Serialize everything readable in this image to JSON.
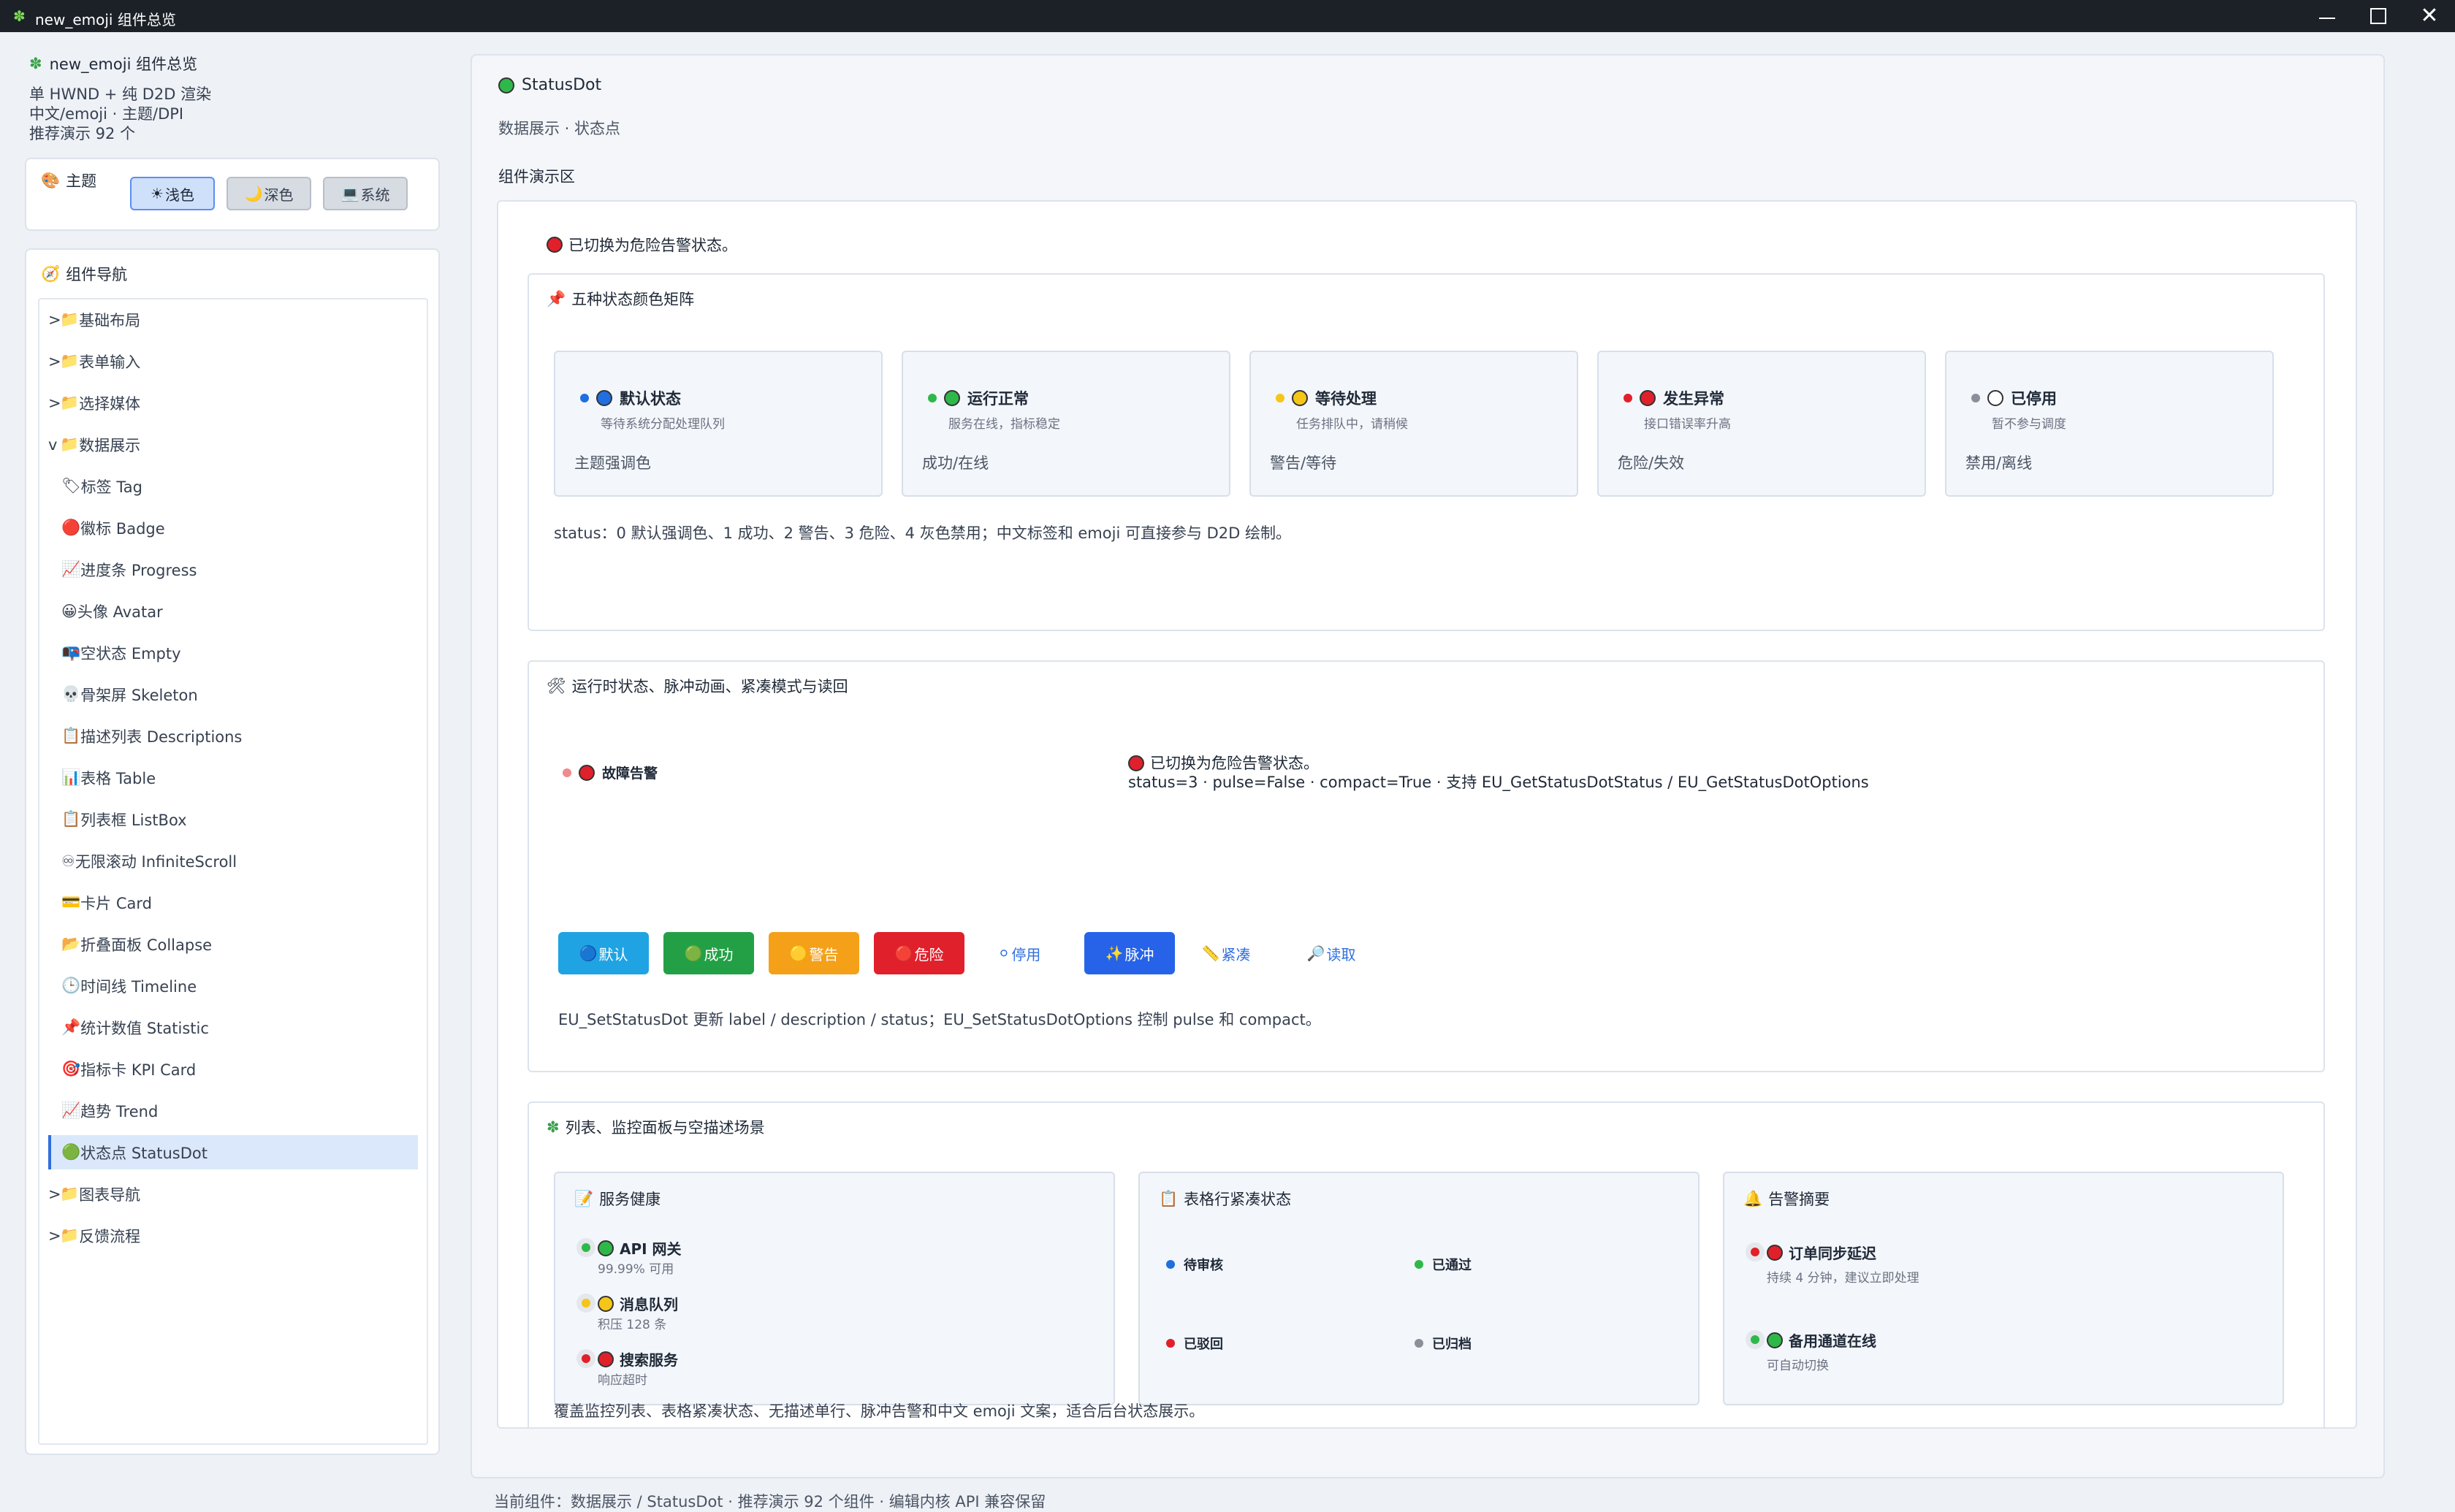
{
  "window": {
    "title": "new_emoji 组件总览"
  },
  "sidebar": {
    "title": "new_emoji 组件总览",
    "info": [
      "单 HWND + 纯 D2D 渲染",
      "中文/emoji · 主题/DPI",
      "推荐演示 92 个"
    ],
    "theme": {
      "label": "主题",
      "buttons": [
        {
          "icon": "☀",
          "label": "浅色"
        },
        {
          "icon": "🌙",
          "label": "深色"
        },
        {
          "icon": "💻",
          "label": "系统"
        }
      ]
    },
    "nav": {
      "label": "组件导航",
      "items": [
        {
          "caret": ">",
          "icon": "📁",
          "label": "基础布局"
        },
        {
          "caret": ">",
          "icon": "📁",
          "label": "表单输入"
        },
        {
          "caret": ">",
          "icon": "📁",
          "label": "选择媒体"
        },
        {
          "caret": "v",
          "icon": "📁",
          "label": "数据展示"
        },
        {
          "icon": "🏷",
          "label": "标签 Tag"
        },
        {
          "icon": "🔴",
          "label": "徽标 Badge"
        },
        {
          "icon": "📈",
          "label": "进度条 Progress"
        },
        {
          "icon": "😀",
          "label": "头像 Avatar"
        },
        {
          "icon": "📭",
          "label": "空状态 Empty"
        },
        {
          "icon": "💀",
          "label": "骨架屏 Skeleton"
        },
        {
          "icon": "📋",
          "label": "描述列表 Descriptions"
        },
        {
          "icon": "📊",
          "label": "表格 Table"
        },
        {
          "icon": "📋",
          "label": "列表框 ListBox"
        },
        {
          "icon": "♾",
          "label": "无限滚动 InfiniteScroll"
        },
        {
          "icon": "💳",
          "label": "卡片 Card"
        },
        {
          "icon": "📂",
          "label": "折叠面板 Collapse"
        },
        {
          "icon": "🕒",
          "label": "时间线 Timeline"
        },
        {
          "icon": "📌",
          "label": "统计数值 Statistic"
        },
        {
          "icon": "🎯",
          "label": "指标卡 KPI Card"
        },
        {
          "icon": "📈",
          "label": "趋势 Trend"
        },
        {
          "icon": "🟢",
          "label": "状态点 StatusDot"
        },
        {
          "caret": ">",
          "icon": "📁",
          "label": "图表导航"
        },
        {
          "caret": ">",
          "icon": "📁",
          "label": "反馈流程"
        }
      ]
    }
  },
  "main": {
    "title": "StatusDot",
    "subtitle": "数据展示 · 状态点",
    "demo_label": "组件演示区",
    "message": "已切换为危险告警状态。",
    "matrix": {
      "title": "五种状态颜色矩阵",
      "states": [
        {
          "label": "默认状态",
          "desc": "等待系统分配处理队列",
          "category": "主题强调色",
          "color": "#1f6fe0"
        },
        {
          "label": "运行正常",
          "desc": "服务在线，指标稳定",
          "category": "成功/在线",
          "color": "#2fb84a"
        },
        {
          "label": "等待处理",
          "desc": "任务排队中，请稍候",
          "category": "警告/等待",
          "color": "#f5c518"
        },
        {
          "label": "发生异常",
          "desc": "接口错误率升高",
          "category": "危险/失效",
          "color": "#e0202b"
        },
        {
          "label": "已停用",
          "desc": "暂不参与调度",
          "category": "禁用/离线",
          "color": "#ffffff"
        }
      ],
      "note": "status：0 默认强调色、1 成功、2 警告、3 危险、4 灰色禁用；中文标签和 emoji 可直接参与 D2D 绘制。"
    },
    "runtime": {
      "title": "运行时状态、脉冲动画、紧凑模式与读回",
      "status_label": "故障告警",
      "msg1": "已切换为危险告警状态。",
      "msg2": "status=3 · pulse=False · compact=True · 支持 EU_GetStatusDotStatus / EU_GetStatusDotOptions",
      "buttons": [
        {
          "icon": "🔵",
          "label": "默认",
          "bg": "#1fa3e3",
          "fg": "#ffffff"
        },
        {
          "icon": "🟢",
          "label": "成功",
          "bg": "#23a046",
          "fg": "#ffffff"
        },
        {
          "icon": "🟡",
          "label": "警告",
          "bg": "#f5a019",
          "fg": "#ffffff"
        },
        {
          "icon": "🔴",
          "label": "危险",
          "bg": "#e0202b",
          "fg": "#ffffff"
        },
        {
          "icon": "⚪",
          "label": "停用",
          "bg": "#ffffff",
          "fg": "#2f6fdf"
        },
        {
          "icon": "✨",
          "label": "脉冲",
          "bg": "#2663e9",
          "fg": "#ffffff"
        },
        {
          "icon": "📏",
          "label": "紧凑",
          "bg": "#ffffff",
          "fg": "#2f6fdf"
        },
        {
          "icon": "🔎",
          "label": "读取",
          "bg": "#ffffff",
          "fg": "#2f6fdf"
        }
      ],
      "note": "EU_SetStatusDot 更新 label / description / status；EU_SetStatusDotOptions 控制 pulse 和 compact。"
    },
    "scenes": {
      "title": "列表、监控面板与空描述场景",
      "health": {
        "title": "服务健康",
        "items": [
          {
            "name": "API 网关",
            "meta": "99.99% 可用",
            "color": "#2fb84a"
          },
          {
            "name": "消息队列",
            "meta": "积压 128 条",
            "color": "#f5c518"
          },
          {
            "name": "搜索服务",
            "meta": "响应超时",
            "color": "#e0202b"
          }
        ]
      },
      "compact_rows": {
        "title": "表格行紧凑状态",
        "items": [
          {
            "label": "待审核",
            "color": "#1f6fe0"
          },
          {
            "label": "已通过",
            "color": "#2fb84a"
          },
          {
            "label": "已驳回",
            "color": "#e0202b"
          },
          {
            "label": "已归档",
            "color": "#8a8f99"
          }
        ]
      },
      "alerts": {
        "title": "告警摘要",
        "items": [
          {
            "name": "订单同步延迟",
            "meta": "持续 4 分钟，建议立即处理",
            "color": "#e0202b"
          },
          {
            "name": "备用通道在线",
            "meta": "可自动切换",
            "color": "#2fb84a"
          }
        ]
      },
      "note": "覆盖监控列表、表格紧凑状态、无描述单行、脉冲告警和中文 emoji 文案，适合后台状态展示。"
    }
  },
  "statusbar": "当前组件：数据展示 / StatusDot · 推荐演示 92 个组件 · 编辑内核 API 兼容保留"
}
